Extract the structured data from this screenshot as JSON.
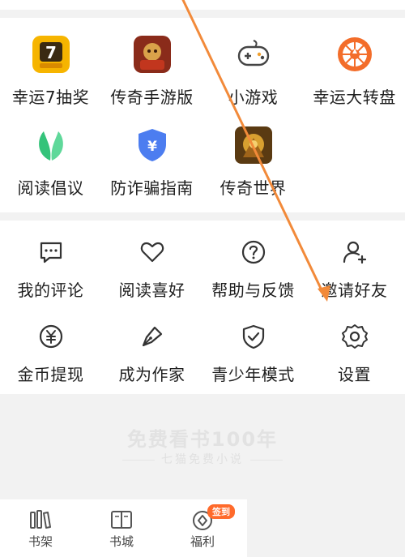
{
  "colors": {
    "accent": "#f08a3e",
    "arrow": "#f28a3a",
    "badge": "#ff6a2b",
    "shield": "#4c7df0",
    "leaf": "#34c37a"
  },
  "apps": [
    {
      "name": "lucky7-icon",
      "label": "幸运7抽奖"
    },
    {
      "name": "legend-mobile-icon",
      "label": "传奇手游版"
    },
    {
      "name": "gamepad-icon",
      "label": "小游戏"
    },
    {
      "name": "wheel-icon",
      "label": "幸运大转盘"
    },
    {
      "name": "leaf-icon",
      "label": "阅读倡议"
    },
    {
      "name": "shield-yuan-icon",
      "label": "防诈骗指南"
    },
    {
      "name": "legend-world-icon",
      "label": "传奇世界"
    }
  ],
  "tools": [
    {
      "name": "comment-icon",
      "label": "我的评论"
    },
    {
      "name": "heart-icon",
      "label": "阅读喜好"
    },
    {
      "name": "help-icon",
      "label": "帮助与反馈"
    },
    {
      "name": "add-friend-icon",
      "label": "邀请好友"
    },
    {
      "name": "coin-icon",
      "label": "金币提现"
    },
    {
      "name": "pen-icon",
      "label": "成为作家"
    },
    {
      "name": "shield-check-icon",
      "label": "青少年模式"
    },
    {
      "name": "gear-icon",
      "label": "设置"
    }
  ],
  "promo": {
    "title": "免费看书100年",
    "subtitle": "七猫免费小说"
  },
  "bottom_nav": [
    {
      "name": "bookshelf-icon",
      "label": "书架"
    },
    {
      "name": "bookstore-icon",
      "label": "书城"
    },
    {
      "name": "welfare-icon",
      "label": "福利",
      "badge": "签到"
    }
  ]
}
